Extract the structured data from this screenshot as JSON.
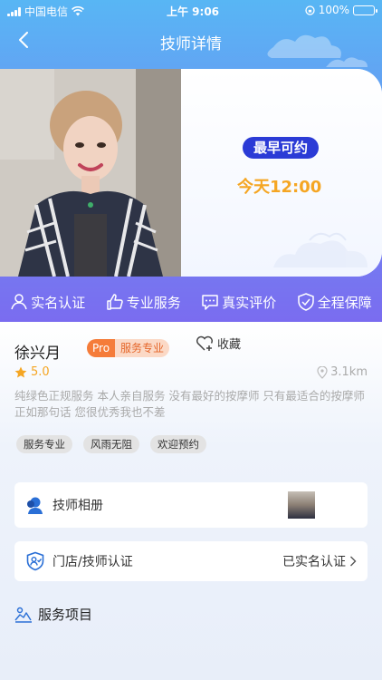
{
  "status_bar": {
    "carrier": "中国电信",
    "time": "上午 9:06",
    "battery": "100%"
  },
  "nav": {
    "title": "技师详情"
  },
  "hero": {
    "earliest_label": "最早可约",
    "today_time": "今天12:00"
  },
  "features": [
    {
      "label": "实名认证",
      "icon": "user-verified-icon"
    },
    {
      "label": "专业服务",
      "icon": "thumbs-up-icon"
    },
    {
      "label": "真实评价",
      "icon": "chat-bubble-icon"
    },
    {
      "label": "全程保障",
      "icon": "shield-check-icon"
    }
  ],
  "profile": {
    "name": "徐兴月",
    "badge_pro": "Pro",
    "badge_text": "服务专业",
    "favorite_label": "收藏",
    "rating": "5.0",
    "distance": "3.1km",
    "description": "纯绿色正规服务 本人亲自服务 没有最好的按摩师 只有最适合的按摩师 正如那句话 您很优秀我也不差",
    "tags": [
      "服务专业",
      "风雨无阻",
      "欢迎预约"
    ]
  },
  "album": {
    "label": "技师相册"
  },
  "certification": {
    "label": "门店/技师认证",
    "status": "已实名认证"
  },
  "services": {
    "title": "服务项目"
  },
  "colors": {
    "accent_blue": "#2b3bd6",
    "time_orange": "#f5a623",
    "badge_orange": "#f57c3a",
    "header_gradient_top": "#58b6f4",
    "header_gradient_bottom": "#7a6cf0"
  }
}
